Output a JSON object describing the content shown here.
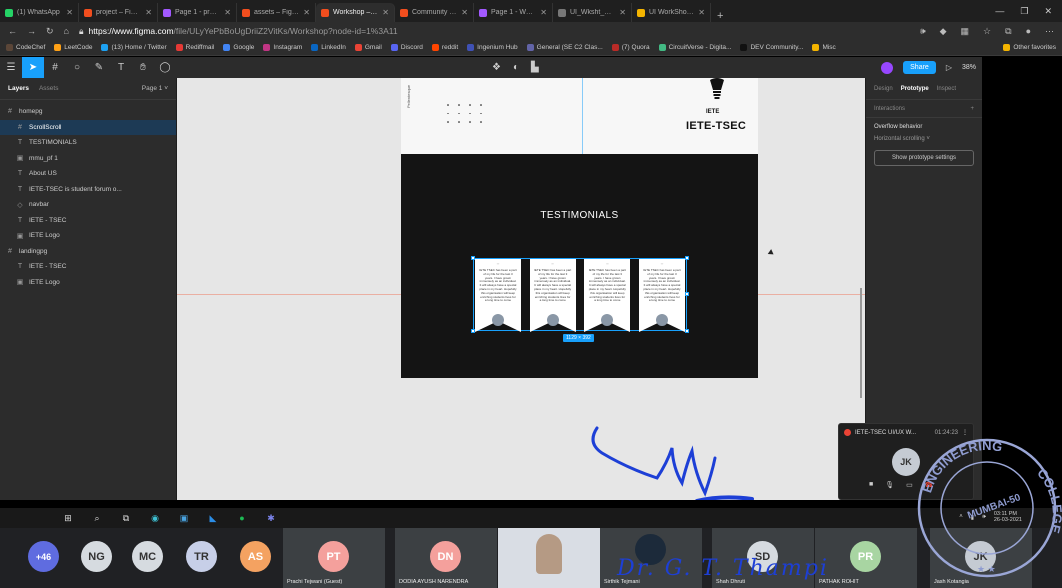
{
  "browser": {
    "tabs": [
      {
        "label": "(1) WhatsApp",
        "color": "#25d366"
      },
      {
        "label": "project – Figma",
        "color": "#f24e1e"
      },
      {
        "label": "Page 1 - project",
        "color": "#a259ff"
      },
      {
        "label": "assets – Figma",
        "color": "#f24e1e"
      },
      {
        "label": "Workshop – Figma",
        "color": "#f24e1e"
      },
      {
        "label": "Community – Figma",
        "color": "#f24e1e"
      },
      {
        "label": "Page 1 - Workshop",
        "color": "#a259ff"
      },
      {
        "label": "UI_Wksht_materials",
        "color": "#777777"
      },
      {
        "label": "UI WorkShop.ppt - Go",
        "color": "#f4b400"
      }
    ],
    "active_tab_index": 4,
    "url_host": "https://www.figma.com",
    "url_path": "/file/ULyYePbBoUgDriiZ2VitKs/Workshop?node-id=1%3A11",
    "bookmarks": [
      {
        "label": "CodeChef",
        "color": "#5b4638"
      },
      {
        "label": "LeetCode",
        "color": "#ffa116"
      },
      {
        "label": "(13) Home / Twitter",
        "color": "#1da1f2"
      },
      {
        "label": "Rediffmail",
        "color": "#e53935"
      },
      {
        "label": "Google",
        "color": "#4285f4"
      },
      {
        "label": "Instagram",
        "color": "#c13584"
      },
      {
        "label": "LinkedIn",
        "color": "#0a66c2"
      },
      {
        "label": "Gmail",
        "color": "#ea4335"
      },
      {
        "label": "Discord",
        "color": "#5865f2"
      },
      {
        "label": "reddit",
        "color": "#ff4500"
      },
      {
        "label": "Ingenium Hub",
        "color": "#3f51b5"
      },
      {
        "label": "General (SE C2 Clas...",
        "color": "#6264a7"
      },
      {
        "label": "(7) Quora",
        "color": "#b92b27"
      },
      {
        "label": "CircuitVerse - Digita...",
        "color": "#42b983"
      },
      {
        "label": "DEV Community...",
        "color": "#111111"
      },
      {
        "label": "Misc",
        "color": "#f4b400"
      }
    ],
    "other_favorites": "Other favorites"
  },
  "figma": {
    "toolbar": {
      "share_label": "Share",
      "zoom": "38%"
    },
    "layers_panel": {
      "tab_layers": "Layers",
      "tab_assets": "Assets",
      "page": "Page 1",
      "items": [
        {
          "label": "homepg",
          "icon": "#",
          "indent": 6,
          "selected": false
        },
        {
          "label": "ScrollScroll",
          "icon": "#",
          "indent": 16,
          "selected": true
        },
        {
          "label": "TESTIMONIALS",
          "icon": "T",
          "indent": 16,
          "selected": false
        },
        {
          "label": "mmu_pf 1",
          "icon": "▣",
          "indent": 16,
          "selected": false
        },
        {
          "label": "About US",
          "icon": "T",
          "indent": 16,
          "selected": false
        },
        {
          "label": "IETE-TSEC is student forum o...",
          "icon": "T",
          "indent": 16,
          "selected": false
        },
        {
          "label": "navbar",
          "icon": "◇",
          "indent": 16,
          "selected": false
        },
        {
          "label": "IETE - TSEC",
          "icon": "T",
          "indent": 16,
          "selected": false
        },
        {
          "label": "IETE Logo",
          "icon": "▣",
          "indent": 16,
          "selected": false
        },
        {
          "label": "landingpg",
          "icon": "#",
          "indent": 6,
          "selected": false
        },
        {
          "label": "IETE - TSEC",
          "icon": "T",
          "indent": 16,
          "selected": false
        },
        {
          "label": "IETE Logo",
          "icon": "▣",
          "indent": 16,
          "selected": false
        }
      ]
    },
    "canvas": {
      "logo_small": "IETE",
      "logo_name": "IETE-TSEC",
      "vertical_text": "Pellentesque",
      "section_title": "TESTIMONIALS",
      "card_quote": "\"\"",
      "card_text": "IETE TSEC has been a part of my life for the last 3 years. I have grown immensely as an individual. It will always have a special place in my heart. Hopefully this organisation will keep enriching students lives for a long time to come",
      "selection_size": "1129 × 392"
    },
    "right_panel": {
      "tab_design": "Design",
      "tab_prototype": "Prototype",
      "tab_inspect": "Inspect",
      "interactions": "Interactions",
      "add_icon": "+",
      "overflow_label": "Overflow behavior",
      "overflow_value": "Horizontal scrolling",
      "button": "Show prototype settings"
    }
  },
  "meet": {
    "mini_title": "IETE-TSEC UI/UX W...",
    "mini_time": "01:24:23",
    "mini_avatar": "JK",
    "participants_extra": "+46",
    "avatars": [
      {
        "initials": "NG",
        "color": "#d6dbe0",
        "text": "#333333"
      },
      {
        "initials": "MC",
        "color": "#d6dbe0",
        "text": "#333333"
      },
      {
        "initials": "TR",
        "color": "#c7cfe8",
        "text": "#333333"
      },
      {
        "initials": "AS",
        "color": "#f4a261",
        "text": "#ffffff"
      }
    ],
    "tiles": [
      {
        "initials": "PT",
        "color": "#f4a09c",
        "name": "Prachi Tejwani (Guest)"
      },
      {
        "initials": "DN",
        "color": "#f4a09c",
        "name": "DODIA AYUSH NARENDRA"
      },
      {
        "initials": "",
        "color": "#3c4043",
        "name": ""
      },
      {
        "initials": "",
        "color": "#3c4043",
        "name": "Sirthik Tejmani"
      },
      {
        "initials": "SD",
        "color": "#d6dbe0",
        "name": "Shah Dhruti"
      },
      {
        "initials": "PR",
        "color": "#a8d5a2",
        "name": "PATHAK ROHIT"
      },
      {
        "initials": "JK",
        "color": "#c5cbd3",
        "name": "Jash Kotangia"
      }
    ]
  },
  "taskbar": {
    "time": "03:11 PM",
    "date": "26-03-2021"
  },
  "handwriting": {
    "name": "Dr. G. T. Thampi"
  },
  "stamp": {
    "top_text": "ENGINEERING",
    "right_text": "COLLEGE",
    "bottom_text": "MUMBAI-50"
  }
}
